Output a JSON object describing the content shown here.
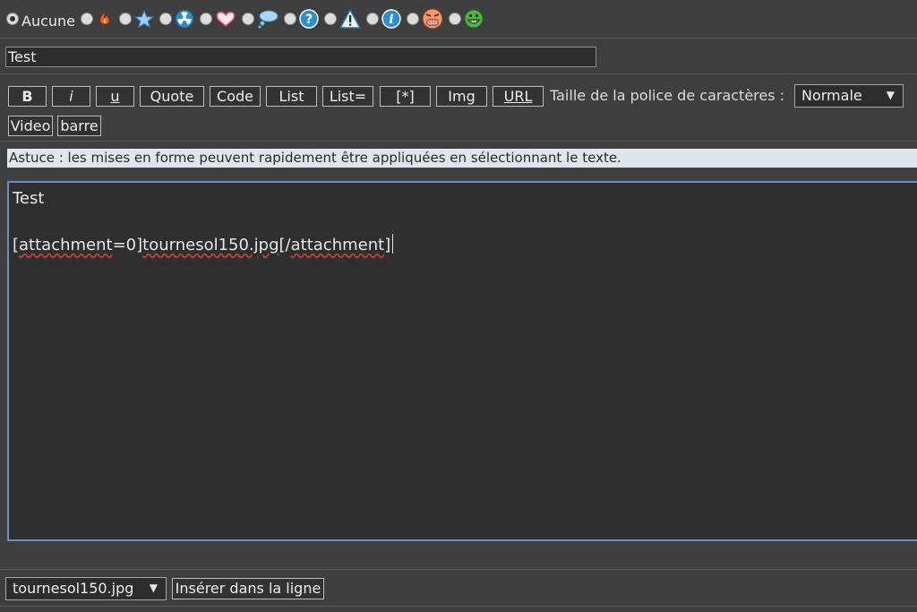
{
  "icons": {
    "none_label": "Aucune",
    "items": [
      "fire-icon",
      "star-icon",
      "radioactive-icon",
      "heart-icon",
      "thought-bubble-icon",
      "question-icon",
      "warning-icon",
      "info-icon",
      "angry-face-icon",
      "grin-face-icon"
    ],
    "selected": "Aucune"
  },
  "subject": {
    "value": "Test"
  },
  "toolbar": {
    "bold": "B",
    "italic": "i",
    "underline": "u",
    "quote": "Quote",
    "code": "Code",
    "list": "List",
    "list_eq": "List=",
    "list_item": "[*]",
    "img": "Img",
    "url": "URL",
    "font_size_label": "Taille de la police de caractères :",
    "font_size_value": "Normale",
    "video": "Video",
    "strike": "barre"
  },
  "tip": "Astuce : les mises en forme peuvent rapidement être appliquées en sélectionnant le texte.",
  "editor": {
    "line1": "Test",
    "line3": {
      "open_bracket": "[",
      "tag_open": "attachment",
      "eq": "=0]",
      "filename": "tournesol150.jpg",
      "close_start": "[/",
      "tag_close": "attachment",
      "close_end": "]"
    }
  },
  "attachments": {
    "selected": "tournesol150.jpg",
    "insert_label": "Insérer dans la ligne"
  },
  "colors": {
    "background": "#3f3f3f",
    "editor_border": "#6d8fbe",
    "tip_background": "#dfe5ea",
    "spellcheck": "#d23a3a"
  }
}
